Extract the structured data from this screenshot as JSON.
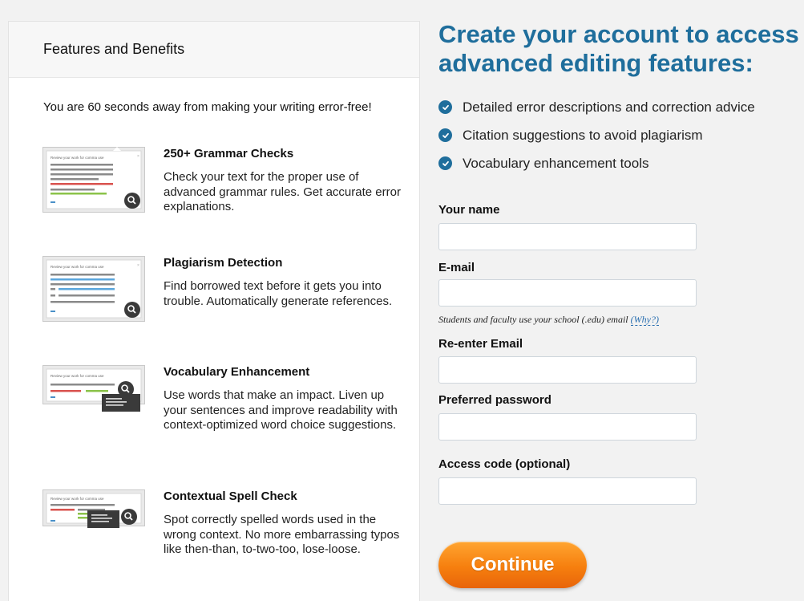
{
  "left": {
    "header_title": "Features and Benefits",
    "intro": "You are 60 seconds away from making your writing error-free!",
    "features": [
      {
        "title": "250+ Grammar Checks",
        "desc": "Check your text for the proper use of advanced grammar rules. Get accurate error explanations.",
        "thumb_caption": "Review your work for comma use"
      },
      {
        "title": "Plagiarism Detection",
        "desc": "Find borrowed text before it gets you into trouble. Automatically generate references.",
        "thumb_caption": "Review your work for comma use"
      },
      {
        "title": "Vocabulary Enhancement",
        "desc": "Use words that make an impact. Liven up your sentences and improve readability with context-optimized word choice suggestions.",
        "thumb_caption": "Review your work for comma use"
      },
      {
        "title": "Contextual Spell Check",
        "desc": "Spot correctly spelled words used in the wrong context. No more embarrassing typos like then-than, to-two-too, lose-loose.",
        "thumb_caption": "Review your work for comma use"
      }
    ]
  },
  "right": {
    "heading": "Create your account to access advanced editing features:",
    "benefits": [
      "Detailed error descriptions and correction advice",
      "Citation suggestions to avoid plagiarism",
      "Vocabulary enhancement tools"
    ],
    "form": {
      "name_label": "Your name",
      "name_value": "",
      "email_label": "E-mail",
      "email_value": "",
      "email_hint": "Students and faculty use your school (.edu) email",
      "why_link": "(Why?)",
      "reenter_label": "Re-enter Email",
      "reenter_value": "",
      "password_label": "Preferred password",
      "password_value": "",
      "access_label": "Access code (optional)",
      "access_value": "",
      "continue_label": "Continue"
    }
  },
  "colors": {
    "heading_blue": "#1f6e9c",
    "button_orange": "#f67f0e",
    "link_blue": "#2a6fb0",
    "page_bg": "#f2f2f2"
  },
  "icons": {
    "benefit_bullet": "check-circle-icon",
    "thumb_overlay": "magnifier-icon"
  }
}
